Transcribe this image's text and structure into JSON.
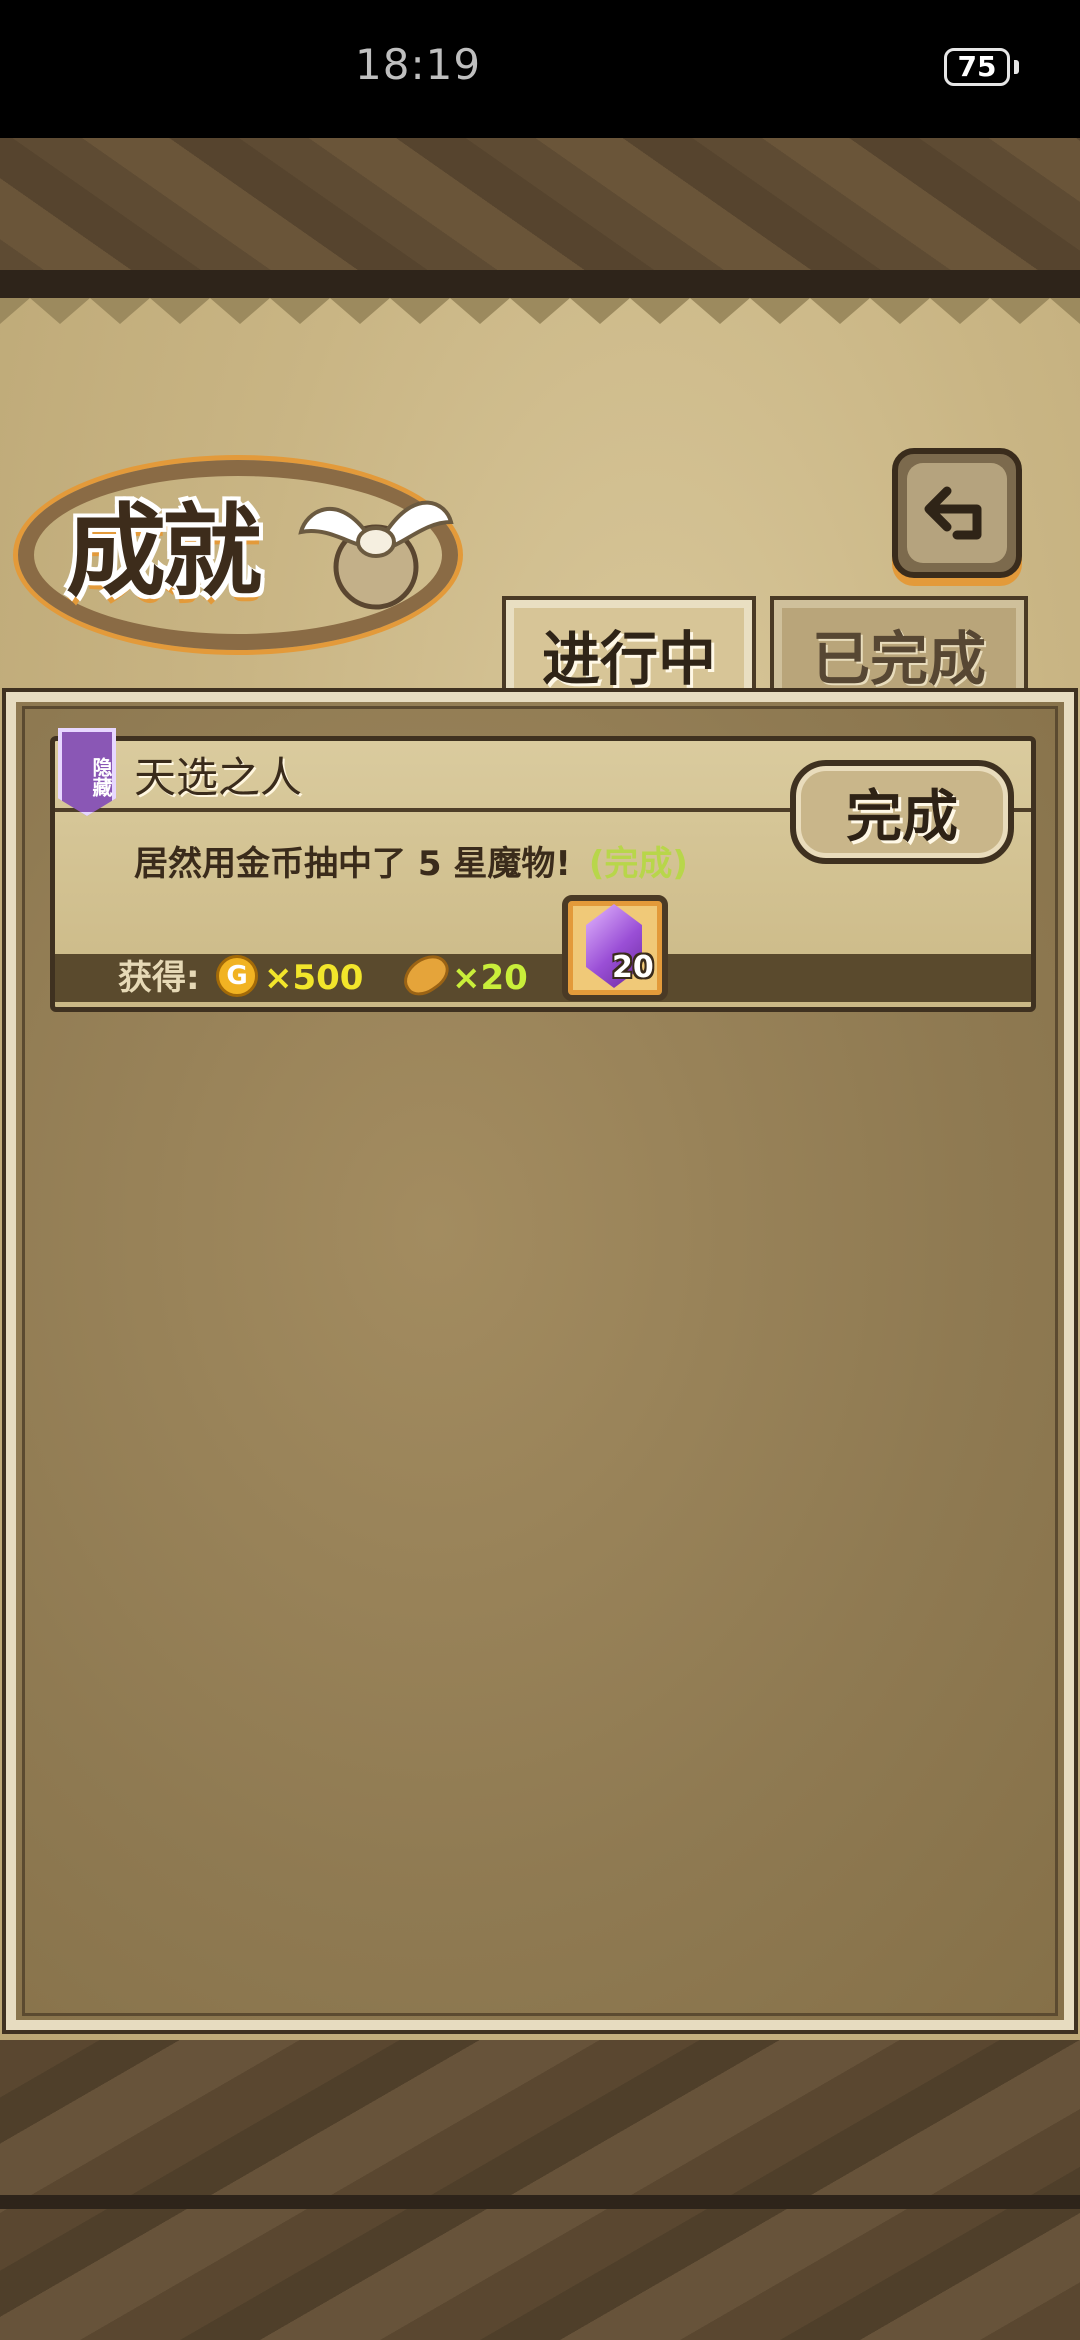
{
  "status_bar": {
    "time": "18:19",
    "battery": "75"
  },
  "header": {
    "title": "成就"
  },
  "tabs": [
    {
      "label": "进行中",
      "active": true
    },
    {
      "label": "已完成",
      "active": false
    }
  ],
  "achievements": [
    {
      "badge": "隐藏",
      "title": "天选之人",
      "description": "居然用金币抽中了 5 星魔物!",
      "status": "(完成)",
      "button_label": "完成",
      "reward_label": "获得:",
      "rewards": {
        "coin_icon_text": "G",
        "coins": "×500",
        "bread": "×20",
        "gem_count": "20"
      }
    }
  ],
  "colors": {
    "accent_orange": "#e39a3a",
    "status_green": "#b8d64a",
    "gem_purple": "#9a4fd6"
  },
  "icons": {
    "back": "back-arrow-icon",
    "coin": "gold-coin-icon",
    "bread": "bread-icon",
    "gem": "purple-gem-icon"
  }
}
